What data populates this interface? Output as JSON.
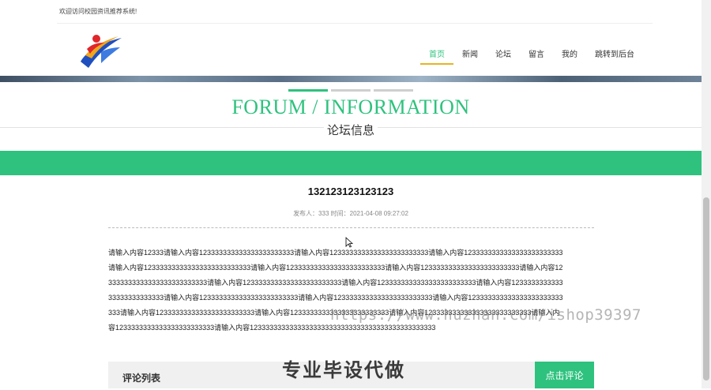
{
  "topbar": {
    "welcome": "欢迎访问校园资讯推荐系统!"
  },
  "nav": {
    "items": [
      {
        "label": "首页",
        "active": true
      },
      {
        "label": "新闻",
        "active": false
      },
      {
        "label": "论坛",
        "active": false
      },
      {
        "label": "留言",
        "active": false
      },
      {
        "label": "我的",
        "active": false
      },
      {
        "label": "跳转到后台",
        "active": false
      }
    ]
  },
  "section": {
    "en_title": "FORUM / INFORMATION",
    "cn_title": "论坛信息"
  },
  "article": {
    "title": "132123123123123",
    "meta": "发布人：333 时间：2021-04-08 09:27:02",
    "body": "请输入内容12333请输入内容123333333333333333333333请输入内容1233333333333333333333333请输入内容1233333333333333333333333请输入内容123333333333333333333333333请输入内容1233333333333333333333333请输入内容1233333333333333333333333请输入内容123333333333333333333333333请输入内容1233333333333333333333333请输入内容1233333333333333333333333请输入内容123333333333333333333333333请输入内容1233333333333333333333333请输入内容1233333333333333333333333请输入内容123333333333333333333333333请输入内容1233333333333333333333333请输入内容1233333333333333333333333请输入内容123333333333333333333333333请输入内容1233333333333333333333333请输入内容12333333333333333333333333333333333333333333333"
  },
  "comments": {
    "label": "评论列表",
    "button": "点击评论"
  },
  "watermark": {
    "url": "https://www.huzhan.com/ishop39397",
    "text": "专业毕设代做"
  },
  "colors": {
    "accent": "#2ec27e",
    "nav_underline": "#e6b422"
  }
}
